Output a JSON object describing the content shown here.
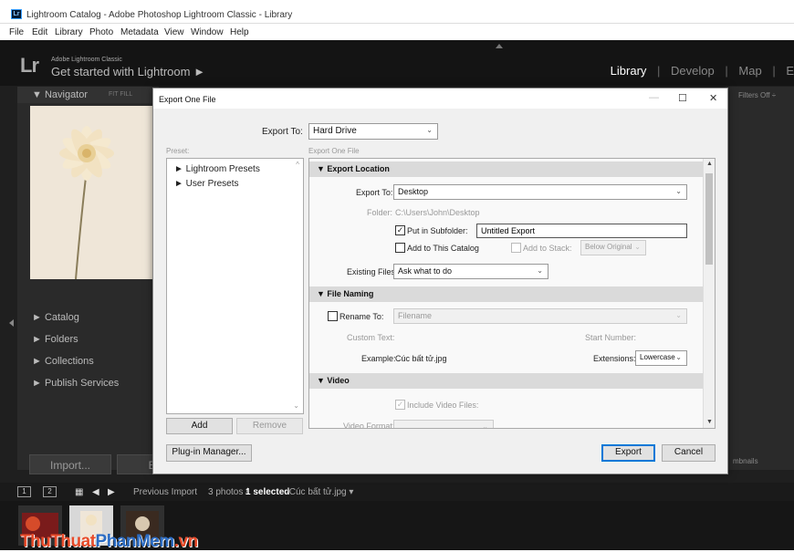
{
  "window": {
    "title": "Lightroom Catalog - Adobe Photoshop Lightroom Classic - Library",
    "menu": [
      "File",
      "Edit",
      "Library",
      "Photo",
      "Metadata",
      "View",
      "Window",
      "Help"
    ]
  },
  "identity": {
    "logo": "Lr",
    "brand_small": "Adobe Lightroom Classic",
    "brand_big": "Get started with Lightroom ►",
    "modules": [
      "Library",
      "Develop",
      "Map",
      "E"
    ],
    "selected_module": "Library"
  },
  "left_panel": {
    "navigator": "▼  Navigator",
    "fit": "FIT  FILL",
    "items": [
      "►  Catalog",
      "►  Folders",
      "►  Collections",
      "►  Publish Services"
    ],
    "import_label": "Import...",
    "export_label": "Exp"
  },
  "right_panel": {
    "filters": "Filters Off ÷",
    "thumbnails": "mbnails"
  },
  "filmstrip_bar": {
    "box1": "1",
    "box2": "2",
    "previous_import": "Previous Import",
    "count_text": "3 photos /",
    "selected_text": "1 selected",
    "file_text": "/Cúc bất tử.jpg ▾"
  },
  "watermark": {
    "part1": "ThuThuat",
    "part2": "PhanMem",
    "part3": ".vn"
  },
  "dialog": {
    "title": "Export One File",
    "min": "—",
    "max": "☐",
    "close": "✕",
    "export_to_label": "Export To:",
    "export_to_value": "Hard Drive",
    "preset_label": "Preset:",
    "settings_label": "Export One File",
    "presets": [
      "►  Lightroom Presets",
      "►  User Presets"
    ],
    "add_label": "Add",
    "remove_label": "Remove",
    "plugin_manager": "Plug-in Manager...",
    "export_btn": "Export",
    "cancel_btn": "Cancel",
    "export_location": {
      "header": "▼  Export Location",
      "export_to_label": "Export To:",
      "export_to_value": "Desktop",
      "folder_label": "Folder:",
      "folder_value": "C:\\Users\\John\\Desktop",
      "put_in_subfolder": "Put in Subfolder:",
      "subfolder_value": "Untitled Export",
      "add_to_catalog": "Add to This Catalog",
      "add_to_stack": "Add to Stack:",
      "stack_value": "Below Original",
      "existing_files_label": "Existing Files:",
      "existing_files_value": "Ask what to do"
    },
    "file_naming": {
      "header": "▼  File Naming",
      "rename_to": "Rename To:",
      "rename_value": "Filename",
      "custom_text": "Custom Text:",
      "start_number": "Start Number:",
      "example_label": "Example:",
      "example_value": "Cúc bất tử.jpg",
      "extensions_label": "Extensions:",
      "extensions_value": "Lowercase"
    },
    "video": {
      "header": "▼  Video",
      "include_video": "Include Video Files:",
      "video_format": "Video Format:"
    }
  }
}
